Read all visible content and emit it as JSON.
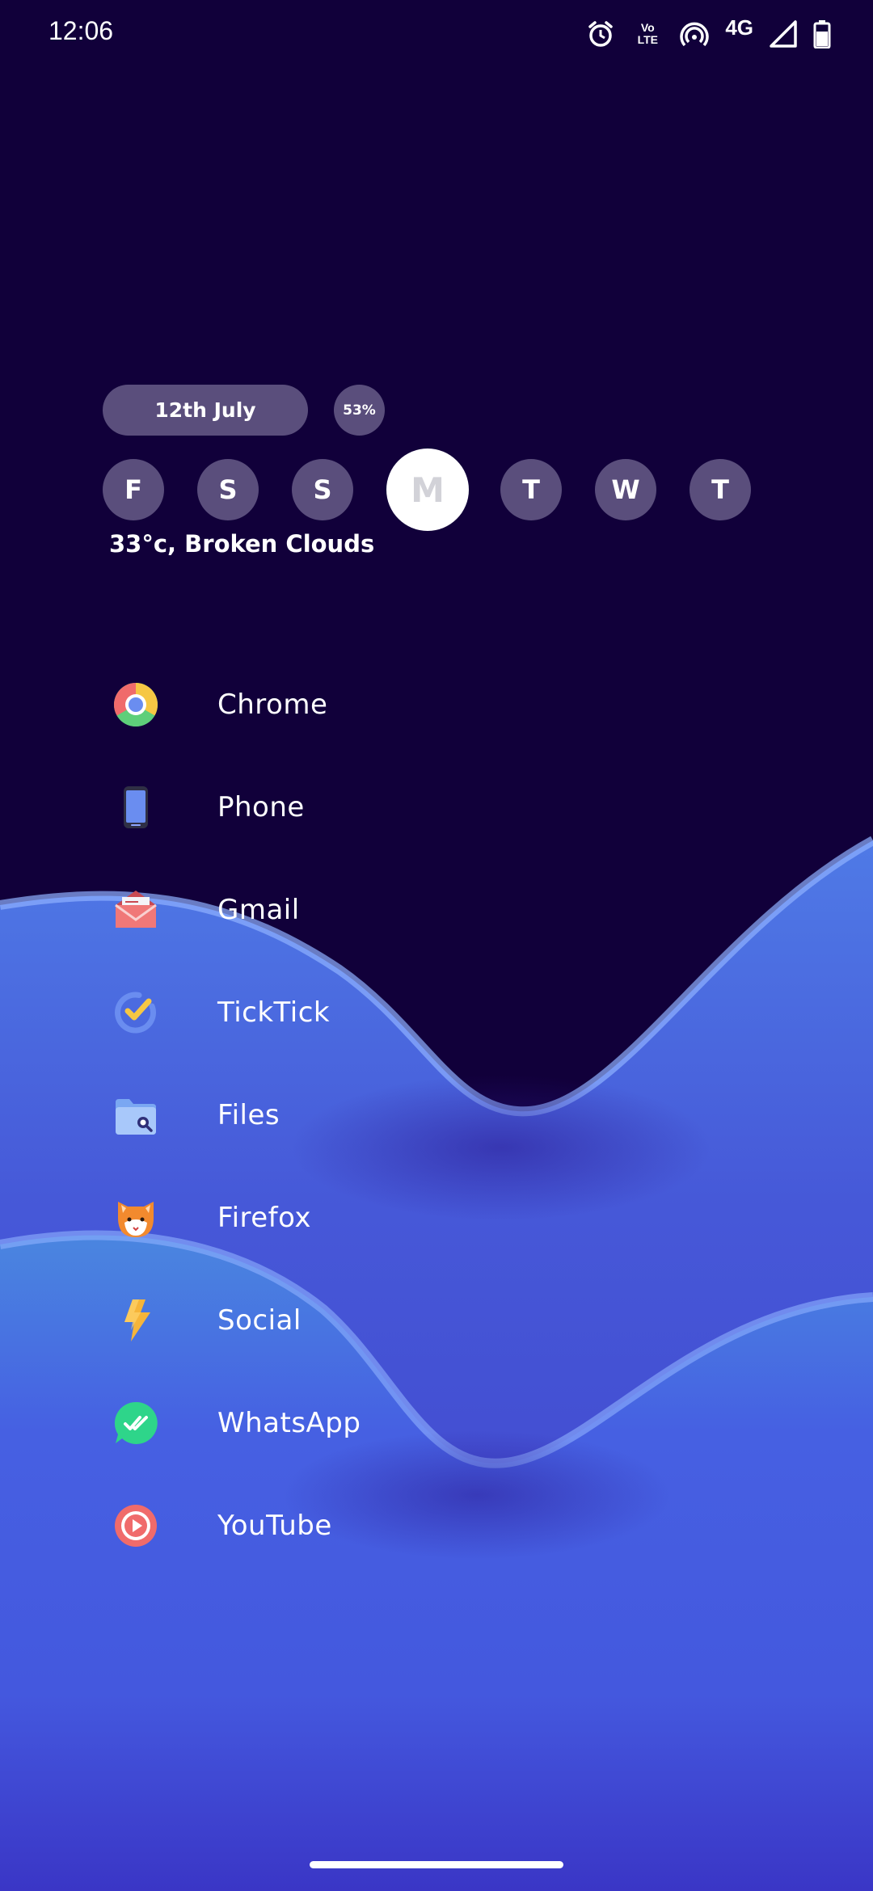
{
  "status_bar": {
    "time": "12:06",
    "volte_top": "Vo",
    "volte_bottom": "LTE",
    "network": "4G",
    "icons": [
      "alarm-icon",
      "volte-icon",
      "hotspot-icon",
      "signal-icon",
      "battery-icon"
    ]
  },
  "widget": {
    "date": "12th July",
    "battery": "53%",
    "days": [
      "F",
      "S",
      "S",
      "M",
      "T",
      "W",
      "T"
    ],
    "active_day": "M",
    "weather": "33°c, Broken Clouds"
  },
  "apps": [
    {
      "label": "Chrome",
      "icon": "chrome-icon"
    },
    {
      "label": "Phone",
      "icon": "phone-icon"
    },
    {
      "label": "Gmail",
      "icon": "gmail-icon"
    },
    {
      "label": "TickTick",
      "icon": "ticktick-icon"
    },
    {
      "label": "Files",
      "icon": "files-icon"
    },
    {
      "label": "Firefox",
      "icon": "firefox-icon"
    },
    {
      "label": "Social",
      "icon": "social-icon"
    },
    {
      "label": "WhatsApp",
      "icon": "whatsapp-icon"
    },
    {
      "label": "YouTube",
      "icon": "youtube-icon"
    }
  ],
  "colors": {
    "background_top": "#11003a",
    "wave_blue": "#4a5fe0",
    "wave_highlight": "#8fb0ff",
    "pill": "#5a4e7c",
    "active_day": "#ffffff"
  }
}
